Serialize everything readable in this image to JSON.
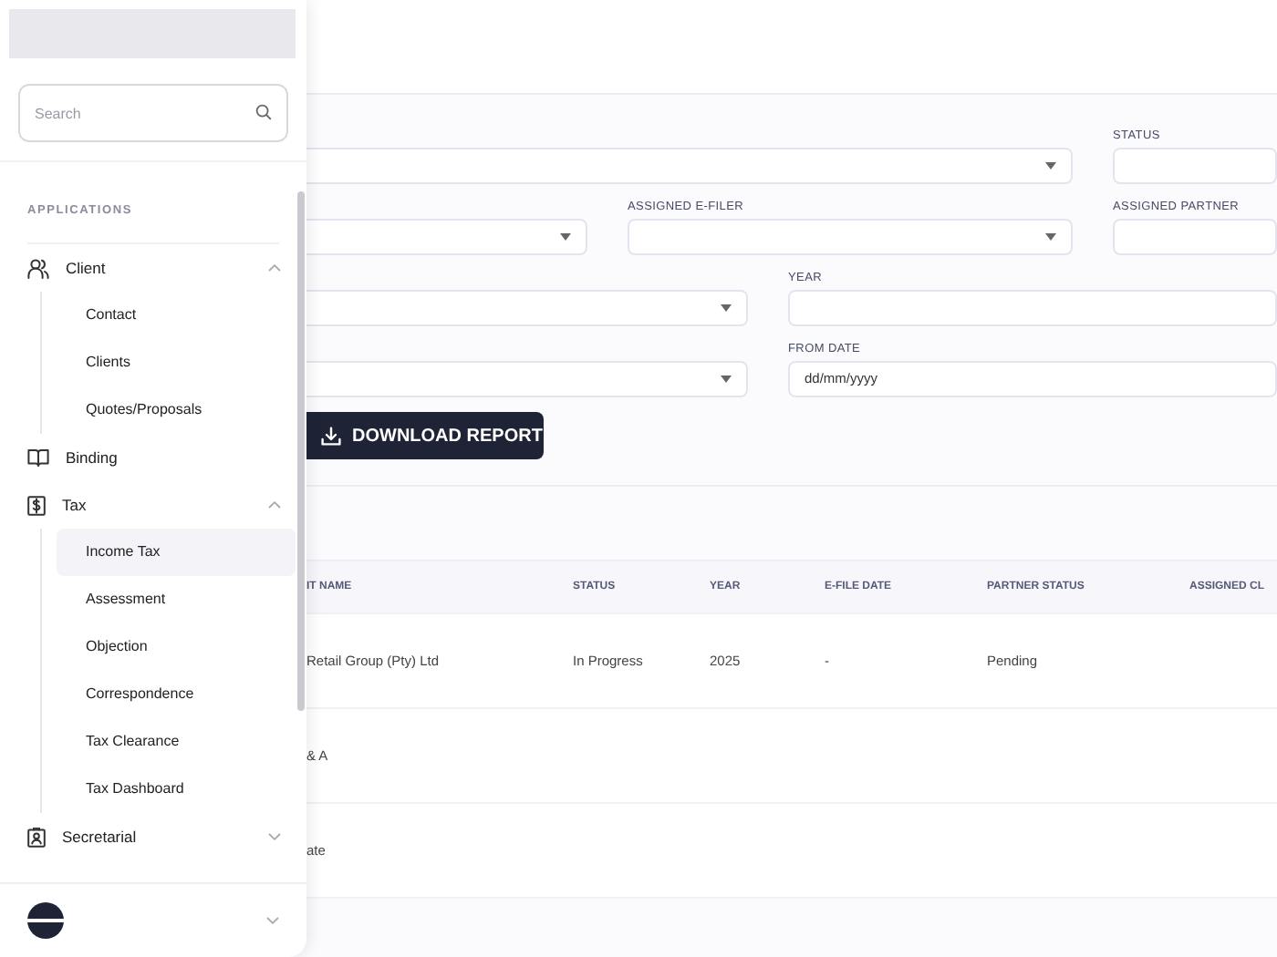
{
  "sidebar": {
    "search": {
      "placeholder": "Search"
    },
    "section": "APPLICATIONS",
    "items": [
      {
        "label": "Client",
        "kind": "group",
        "expanded": true,
        "children": [
          {
            "label": "Contact",
            "selected": false
          },
          {
            "label": "Clients",
            "selected": false
          },
          {
            "label": "Quotes/Proposals",
            "selected": false
          }
        ]
      },
      {
        "label": "Binding",
        "kind": "link"
      },
      {
        "label": "Tax",
        "kind": "group",
        "expanded": true,
        "children": [
          {
            "label": "Income Tax",
            "selected": true
          },
          {
            "label": "Assessment",
            "selected": false
          },
          {
            "label": "Objection",
            "selected": false
          },
          {
            "label": "Correspondence",
            "selected": false
          },
          {
            "label": "Tax Clearance",
            "selected": false
          },
          {
            "label": "Tax Dashboard",
            "selected": false
          }
        ]
      },
      {
        "label": "Secretarial",
        "kind": "group",
        "expanded": false
      }
    ]
  },
  "filters": [
    [
      {
        "kind": "select"
      },
      {
        "kind": "input",
        "label": "STATUS"
      }
    ],
    [
      {
        "kind": "select"
      },
      {
        "kind": "select",
        "label": "ASSIGNED E-FILER"
      },
      {
        "kind": "input",
        "label": "ASSIGNED PARTNER"
      }
    ],
    [
      {
        "kind": "select"
      },
      {
        "kind": "input",
        "label": "YEAR"
      }
    ],
    [
      {
        "kind": "select"
      },
      {
        "kind": "date",
        "label": "FROM DATE",
        "placeholder": "dd/mm/yyyy"
      }
    ]
  ],
  "download_button": "DOWNLOAD REPORT",
  "table": {
    "columns": [
      "IT NAME",
      "STATUS",
      "YEAR",
      "E-FILE DATE",
      "PARTNER STATUS",
      "ASSIGNED CL"
    ],
    "rows": [
      [
        "Retail Group (Pty) Ltd",
        "In Progress",
        "2025",
        "-",
        "Pending",
        ""
      ],
      [
        "& A",
        "",
        "",
        "",
        "",
        ""
      ],
      [
        "ate",
        "",
        "",
        "",
        "",
        ""
      ]
    ]
  }
}
